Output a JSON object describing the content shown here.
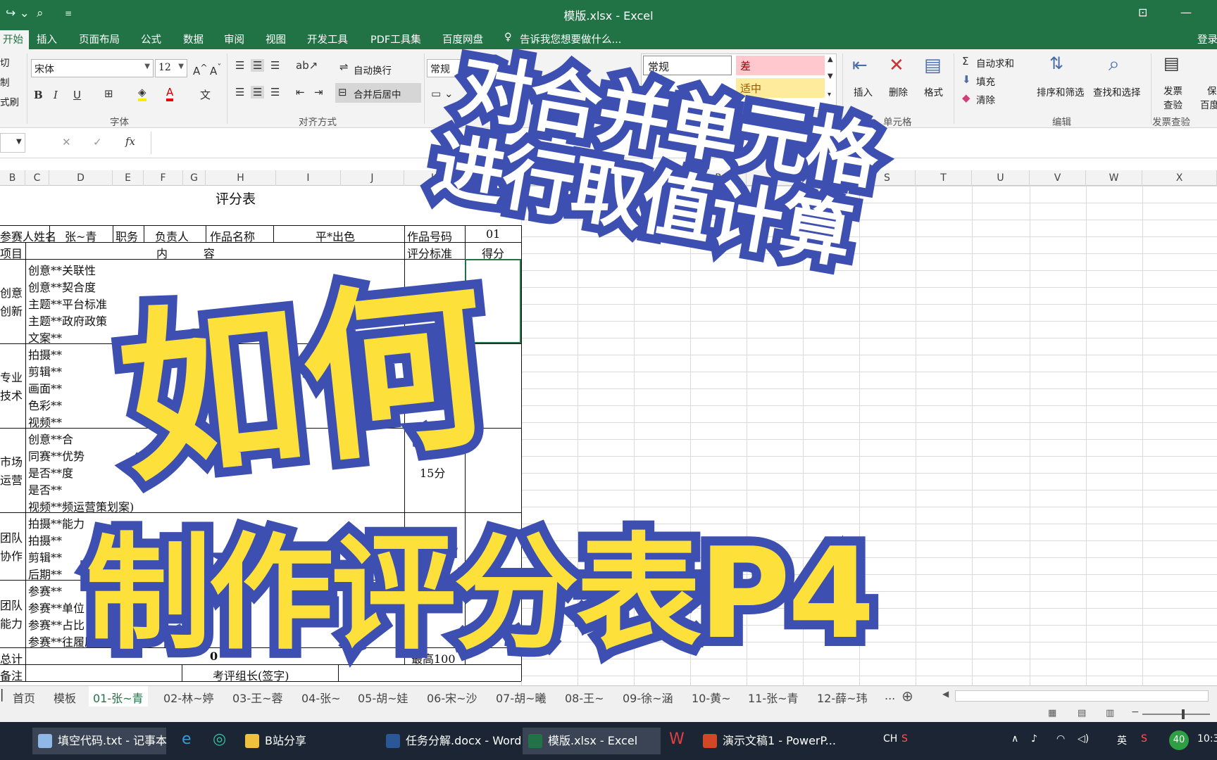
{
  "titlebar": {
    "title": "模版.xlsx - Excel",
    "undo_icon": "undo-arrow-icon",
    "preview_icon": "print-preview-icon"
  },
  "ribbon_tabs": [
    "开始",
    "插入",
    "页面布局",
    "公式",
    "数据",
    "审阅",
    "视图",
    "开发工具",
    "PDF工具集",
    "百度网盘"
  ],
  "tell_me": "告诉我您想要做什么...",
  "login": "登录",
  "clipboard": {
    "cut": "切",
    "copy": "制",
    "format_painter": "式刷"
  },
  "font": {
    "name": "宋体",
    "size": "12",
    "group": "字体"
  },
  "alignment": {
    "wrap": "自动换行",
    "merge": "合并后居中",
    "group": "对齐方式"
  },
  "number": {
    "format": "常规"
  },
  "styles": {
    "normal": "常规",
    "bad": "差",
    "neutral": "适中",
    "bad_bg": "#ffc7ce",
    "neutral_bg": "#ffeb9c"
  },
  "cells": {
    "insert": "插入",
    "delete": "删除",
    "format": "格式",
    "group": "单元格"
  },
  "editing": {
    "autosum": "自动求和",
    "fill": "填充",
    "clear": "清除",
    "sort": "排序和筛选",
    "find": "查找和选择",
    "group": "编辑"
  },
  "invoice": {
    "label1": "发票",
    "label2": "查验",
    "group": "发票查验",
    "extra": "保",
    "extra2": "百度"
  },
  "formula_bar": {
    "fx": "fx",
    "cancel": "✕",
    "confirm": "✓",
    "value": ""
  },
  "columns": [
    "B",
    "C",
    "D",
    "E",
    "F",
    "G",
    "H",
    "I",
    "J",
    "K",
    "L",
    "M",
    "N",
    "O",
    "P",
    "Q",
    "R",
    "S",
    "T",
    "U",
    "V",
    "W",
    "X"
  ],
  "sheet": {
    "title": "评分表",
    "r1": {
      "a": "参赛人姓名",
      "name": "张~青",
      "b": "职务",
      "role": "负责人",
      "c": "作品名称",
      "work": "平*出色",
      "d": "作品号码",
      "num": "01"
    },
    "r2": {
      "a": "项目",
      "content": "内          容",
      "std": "评分标准",
      "score": "得分"
    },
    "groups": [
      {
        "label": "创意\n创新",
        "items": [
          "创意**关联性",
          "创意**契合度",
          "主题**平台标准",
          "主题**政府政策",
          "文案**"
        ],
        "std": "2"
      },
      {
        "label": "专业\n技术",
        "items": [
          "拍摄**",
          "剪辑**",
          "画面**",
          "色彩**",
          "视频**"
        ],
        "std": "1"
      },
      {
        "label": "市场\n运营",
        "items": [
          "创意**合",
          "同赛**优势",
          "是否**度",
          "是否**",
          "视频**频运营策划案)"
        ],
        "std": "15分"
      },
      {
        "label": "团队\n协作",
        "items": [
          "拍摄**能力",
          "拍摄**",
          "剪辑**",
          "后期**"
        ],
        "std": ""
      },
      {
        "label": "团队\n能力",
        "items": [
          "参赛**",
          "参赛**单位",
          "参赛**占比",
          "参赛**往履历"
        ],
        "std": ""
      }
    ],
    "total": {
      "label": "总计",
      "value": "0",
      "max": "最高100"
    },
    "note": {
      "label": "备注",
      "sign": "考评组长(签字)"
    }
  },
  "sheet_tabs": [
    "首页",
    "模板",
    "01-张~青",
    "02-林~婷",
    "03-王~蓉",
    "04-张~",
    "05-胡~娃",
    "06-宋~沙",
    "07-胡~曦",
    "08-王~",
    "09-徐~涵",
    "10-黄~",
    "11-张~青",
    "12-薛~玮",
    "..."
  ],
  "active_sheet": "01-张~青",
  "taskbar": {
    "items": [
      "填空代码.txt - 记事本",
      "B站分享",
      "任务分解.docx - Word",
      "模版.xlsx - Excel",
      "演示文稿1 - PowerP..."
    ],
    "tray": {
      "lang": "CH",
      "ime": "英",
      "badge": "40",
      "time": "10:3"
    }
  },
  "overlay": {
    "line1": "对合并单元格",
    "line2": "进行取值计算",
    "how": "如何",
    "main": "制作评分表P4"
  }
}
